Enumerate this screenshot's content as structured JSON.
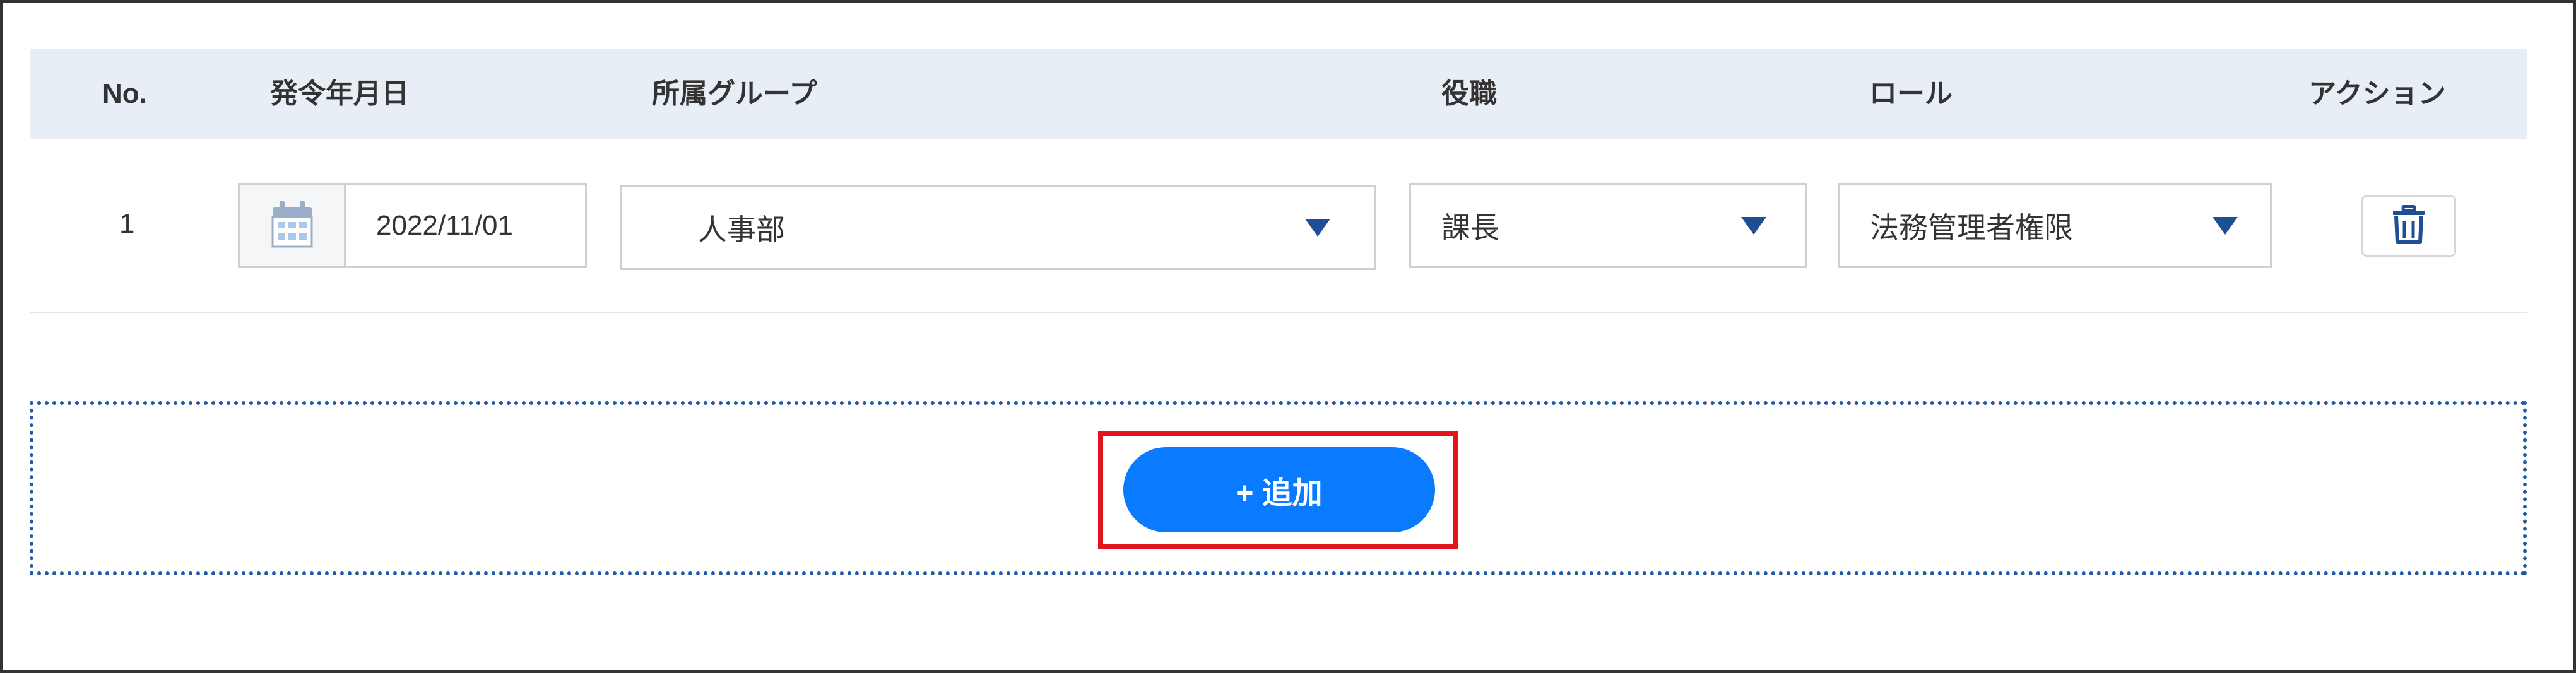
{
  "table": {
    "headers": {
      "no": "No.",
      "date": "発令年月日",
      "group": "所属グループ",
      "position": "役職",
      "role": "ロール",
      "action": "アクション"
    },
    "rows": [
      {
        "no": "1",
        "date": "2022/11/01",
        "group": "人事部",
        "position": "課長",
        "role": "法務管理者権限"
      }
    ]
  },
  "add_button": {
    "label": "+ 追加"
  },
  "icons": {
    "calendar": "calendar-icon",
    "dropdown": "triangle-down-icon",
    "delete": "trash-icon"
  },
  "colors": {
    "header_bg": "#e8eef6",
    "accent_blue": "#0a7bff",
    "caret_blue": "#1e4f94",
    "dotted_border": "#1e5aa6",
    "highlight_red": "#e3141c"
  }
}
